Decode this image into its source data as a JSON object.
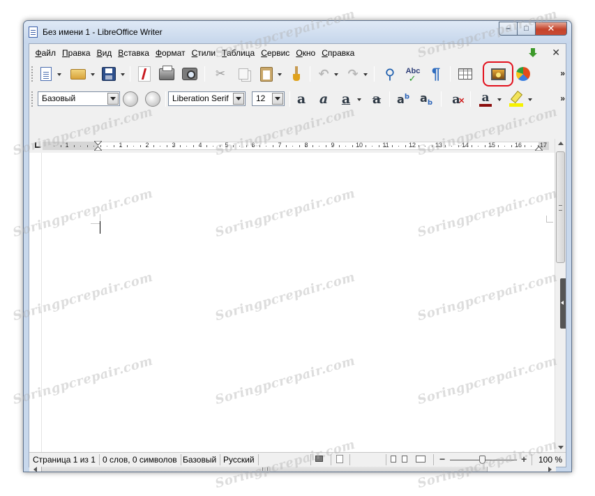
{
  "window": {
    "title": "Без имени 1 - LibreOffice Writer",
    "controls": {
      "minimize": "‒",
      "maximize": "□",
      "close": "✕"
    }
  },
  "menubar": {
    "items": [
      {
        "label": "Файл"
      },
      {
        "label": "Правка"
      },
      {
        "label": "Вид"
      },
      {
        "label": "Вставка"
      },
      {
        "label": "Формат"
      },
      {
        "label": "Стили"
      },
      {
        "label": "Таблица"
      },
      {
        "label": "Сервис"
      },
      {
        "label": "Окно"
      },
      {
        "label": "Справка"
      }
    ],
    "close_doc": "✕"
  },
  "toolbar_standard": {
    "icons": [
      "new-document-icon",
      "open-folder-icon",
      "save-floppy-icon",
      "export-pdf-icon",
      "print-icon",
      "print-preview-icon",
      "cut-scissors-icon",
      "copy-icon",
      "paste-clipboard-icon",
      "clone-formatting-brush-icon",
      "undo-arrow-icon",
      "redo-arrow-icon",
      "find-replace-icon",
      "spellcheck-abc-icon",
      "formatting-marks-pilcrow-icon",
      "insert-table-icon",
      "insert-image-icon",
      "insert-chart-icon"
    ],
    "highlighted": "insert-image-icon",
    "highlight_color": "#e2101c",
    "overflow": "»"
  },
  "toolbar_formatting": {
    "paragraph_style": "Базовый",
    "font_name": "Liberation Serif",
    "font_size": "12",
    "bold": "a",
    "italic": "a",
    "underline": "a",
    "strikethrough": "a",
    "superscript": {
      "base": "a",
      "mark": "b"
    },
    "subscript": {
      "base": "a",
      "mark": "b"
    },
    "clear_formatting": "a",
    "font_color": "a",
    "font_color_value": "#8b0d0d",
    "highlight_color_value": "#f6f200",
    "overflow": "»"
  },
  "ruler": {
    "numbers": [
      "1",
      "1",
      "1",
      "2",
      "3",
      "4",
      "5",
      "6",
      "7",
      "8",
      "9",
      "10",
      "11",
      "12",
      "13",
      "14",
      "15",
      "16",
      "17"
    ]
  },
  "statusbar": {
    "page": "Страница 1 из 1",
    "words": "0 слов, 0 символов",
    "style": "Базовый",
    "language": "Русский",
    "zoom": "100 %",
    "zoom_minus": "−",
    "zoom_plus": "+"
  },
  "watermark": {
    "text": "Soringpcrepair.com"
  }
}
